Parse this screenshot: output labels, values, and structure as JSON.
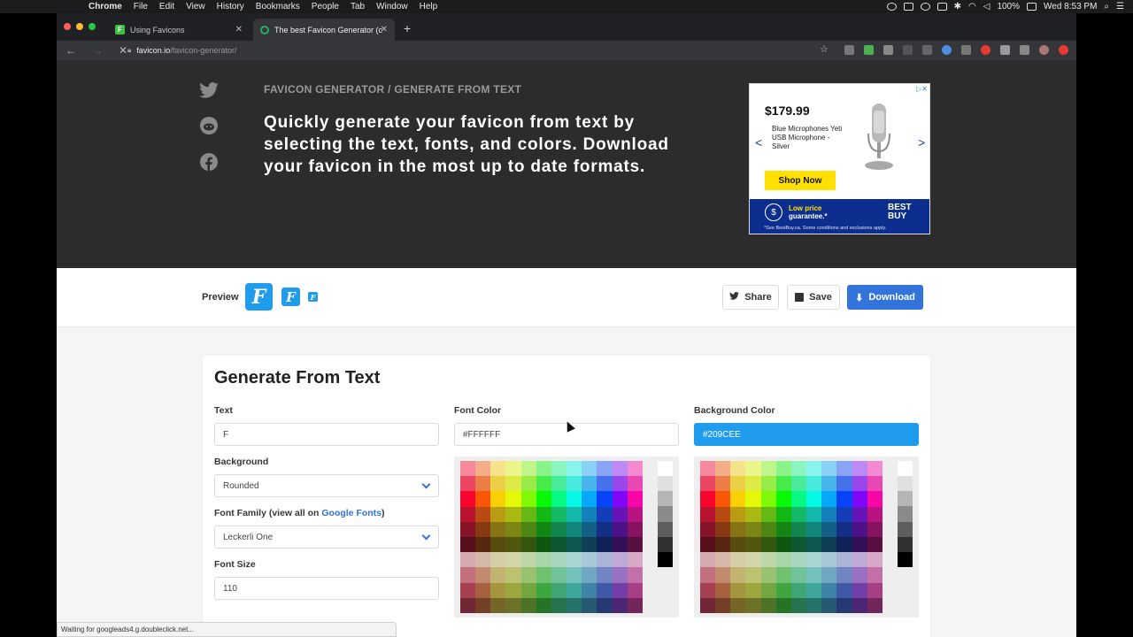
{
  "menubar": {
    "app": "Chrome",
    "items": [
      "File",
      "Edit",
      "View",
      "History",
      "Bookmarks",
      "People",
      "Tab",
      "Window",
      "Help"
    ],
    "battery": "100%",
    "clock": "Wed 8:53 PM"
  },
  "tabs": [
    {
      "title": "Using Favicons",
      "favicon_letter": "F",
      "favicon_color": "#3fbf3f"
    },
    {
      "title": "The best Favicon Generator (c",
      "favicon_color": "#27ae60"
    }
  ],
  "address": {
    "host": "favicon.io",
    "path": "/favicon-generator/"
  },
  "hero": {
    "breadcrumb": "FAVICON GENERATOR / GENERATE FROM TEXT",
    "headline": "Quickly generate your favicon from text by selecting the text, fonts, and colors. Download your favicon in the most up to date formats."
  },
  "social_icons": [
    "twitter-icon",
    "reddit-icon",
    "facebook-icon"
  ],
  "ad": {
    "price": "$179.99",
    "product": "Blue Microphones Yeti USB Microphone - Silver",
    "cta": "Shop Now",
    "tagline_1": "Low price",
    "tagline_2": "guarantee.*",
    "brand_1": "BEST",
    "brand_2": "BUY",
    "note": "*See BestBuy.ca. Some conditions and exclusions apply."
  },
  "preview": {
    "label": "Preview",
    "letter": "F",
    "share": "Share",
    "save": "Save",
    "download": "Download"
  },
  "form": {
    "title": "Generate From Text",
    "text_label": "Text",
    "text_value": "F",
    "background_label": "Background",
    "background_value": "Rounded",
    "font_family_label": "Font Family (view all on",
    "font_family_link": "Google Fonts",
    "font_family_close": ")",
    "font_family_value": "Leckerli One",
    "font_size_label": "Font Size",
    "font_size_value": "110",
    "font_color_label": "Font Color",
    "font_color_value": "#FFFFFF",
    "bg_color_label": "Background Color",
    "bg_color_value": "#209CEE"
  },
  "colors": {
    "accent": "#209cee",
    "primary_button": "#3273dc",
    "hero_bg": "#2c2c2c"
  },
  "status_bar": "Waiting for googleads4.g.doubleclick.net..."
}
